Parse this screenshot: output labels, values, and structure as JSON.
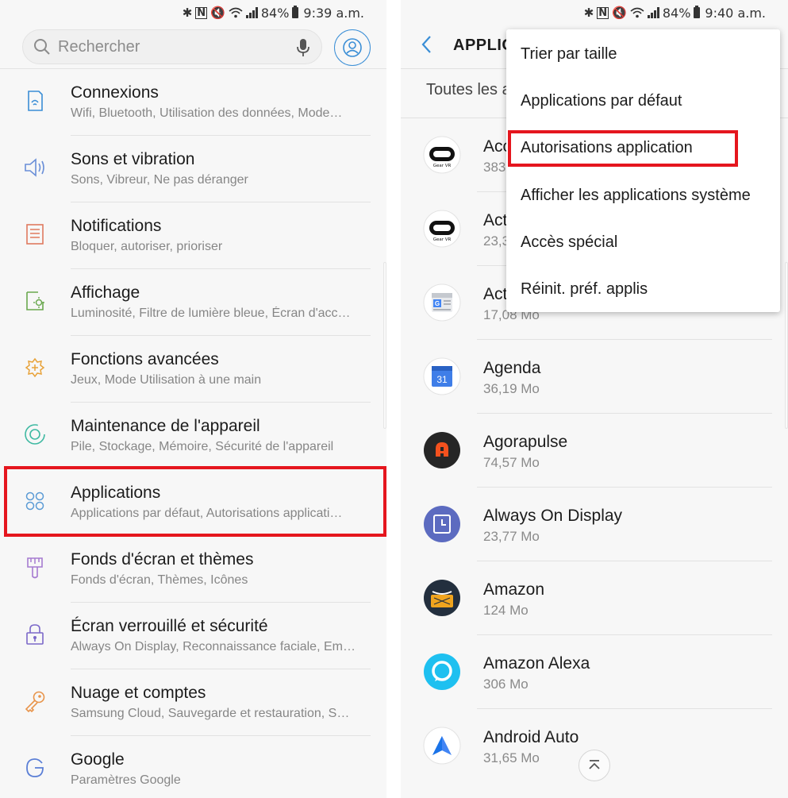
{
  "left": {
    "status": {
      "battery": "84%",
      "time": "9:39 a.m."
    },
    "search": {
      "placeholder": "Rechercher"
    },
    "items": [
      {
        "title": "Connexions",
        "subtitle": "Wifi, Bluetooth, Utilisation des données, Mode…",
        "icon": "connections-icon"
      },
      {
        "title": "Sons et vibration",
        "subtitle": "Sons, Vibreur, Ne pas déranger",
        "icon": "volume-icon"
      },
      {
        "title": "Notifications",
        "subtitle": "Bloquer, autoriser, prioriser",
        "icon": "notifications-icon"
      },
      {
        "title": "Affichage",
        "subtitle": "Luminosité, Filtre de lumière bleue, Écran d'acc…",
        "icon": "display-icon"
      },
      {
        "title": "Fonctions avancées",
        "subtitle": "Jeux, Mode Utilisation à une main",
        "icon": "advanced-features-icon"
      },
      {
        "title": "Maintenance de l'appareil",
        "subtitle": "Pile, Stockage, Mémoire, Sécurité de l'appareil",
        "icon": "device-maintenance-icon"
      },
      {
        "title": "Applications",
        "subtitle": "Applications par défaut, Autorisations applicati…",
        "icon": "apps-grid-icon"
      },
      {
        "title": "Fonds d'écran et thèmes",
        "subtitle": "Fonds d'écran, Thèmes, Icônes",
        "icon": "paintbrush-icon"
      },
      {
        "title": "Écran verrouillé et sécurité",
        "subtitle": "Always On Display, Reconnaissance faciale, Em…",
        "icon": "lock-icon"
      },
      {
        "title": "Nuage et comptes",
        "subtitle": "Samsung Cloud, Sauvegarde et restauration, S…",
        "icon": "key-icon"
      },
      {
        "title": "Google",
        "subtitle": "Paramètres Google",
        "icon": "google-icon"
      }
    ]
  },
  "right": {
    "status": {
      "battery": "84%",
      "time": "9:40 a.m."
    },
    "title": "APPLIC",
    "filter": "Toutes les a",
    "apps": [
      {
        "name": "Acc",
        "size": "383",
        "icon": "gear-vr-icon"
      },
      {
        "name": "Act",
        "size": "23,3",
        "icon": "gear-vr-icon"
      },
      {
        "name": "Act",
        "size": "17,08 Mo",
        "icon": "google-news-icon"
      },
      {
        "name": "Agenda",
        "size": "36,19 Mo",
        "icon": "calendar-icon"
      },
      {
        "name": "Agorapulse",
        "size": "74,57 Mo",
        "icon": "agorapulse-icon"
      },
      {
        "name": "Always On Display",
        "size": "23,77 Mo",
        "icon": "always-on-display-icon"
      },
      {
        "name": "Amazon",
        "size": "124 Mo",
        "icon": "amazon-icon"
      },
      {
        "name": "Amazon Alexa",
        "size": "306 Mo",
        "icon": "alexa-icon"
      },
      {
        "name": "Android Auto",
        "size": "31,65 Mo",
        "icon": "android-auto-icon"
      }
    ],
    "menu": [
      "Trier par taille",
      "Applications par défaut",
      "Autorisations application",
      "Afficher les applications système",
      "Accès spécial",
      "Réinit. préf. applis"
    ],
    "calendar_day": "31",
    "gear_vr_label": "Gear VR"
  },
  "colors": {
    "highlight": "#e5161e",
    "accent": "#3a8ed6"
  }
}
